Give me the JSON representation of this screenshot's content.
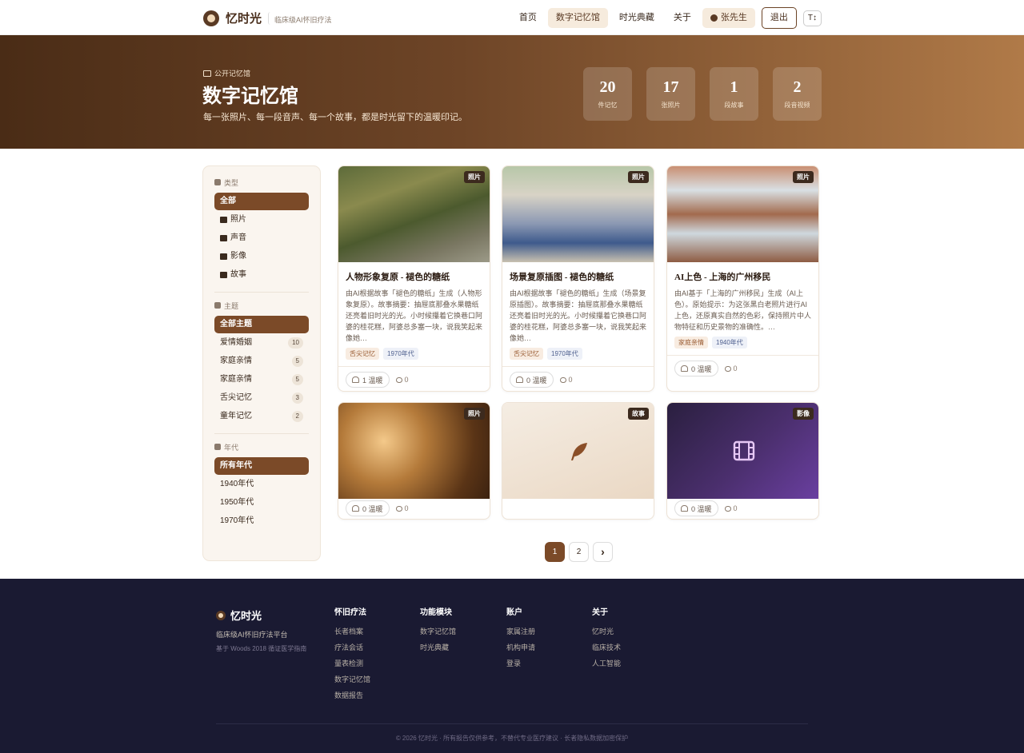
{
  "nav": {
    "brand": "忆时光",
    "tagline": "临床级AI怀旧疗法",
    "links": [
      "首页",
      "数字记忆馆",
      "时光典藏",
      "关于"
    ],
    "user": "张先生",
    "logout": "退出",
    "font_toggle": "T↕"
  },
  "hero": {
    "kicker": "公开记忆馆",
    "title": "数字记忆馆",
    "subtitle": "每一张照片、每一段音声、每一个故事，都是时光留下的温暖印记。",
    "stats": [
      {
        "num": "20",
        "label": "件记忆"
      },
      {
        "num": "17",
        "label": "张照片"
      },
      {
        "num": "1",
        "label": "段故事"
      },
      {
        "num": "2",
        "label": "段音视频"
      }
    ]
  },
  "sidebar": {
    "type_title": "类型",
    "types": [
      "全部",
      "照片",
      "声音",
      "影像",
      "故事"
    ],
    "theme_title": "主题",
    "themes_all": "全部主题",
    "themes": [
      {
        "label": "爱情婚姻",
        "count": "10"
      },
      {
        "label": "家庭亲情",
        "count": "5"
      },
      {
        "label": "家庭亲情",
        "count": "5"
      },
      {
        "label": "舌尖记忆",
        "count": "3"
      },
      {
        "label": "童年记忆",
        "count": "2"
      }
    ],
    "era_title": "年代",
    "eras": [
      "所有年代",
      "1940年代",
      "1950年代",
      "1970年代"
    ]
  },
  "cards": [
    {
      "badge": "照片",
      "title": "人物形象复原 - 褪色的糖纸",
      "desc": "由AI根据故事「褪色的糖纸」生成（人物形象复原）。故事摘要：抽屉底那叠水果糖纸还亮着旧时光的光。小时候攥着它换巷口阿婆的桂花糕，阿婆总多塞一块，说我笑起来像她…",
      "tags": [
        "舌尖记忆",
        "1970年代"
      ],
      "likes": "1 温暖",
      "comments": "0"
    },
    {
      "badge": "照片",
      "title": "场景复原插图 - 褪色的糖纸",
      "desc": "由AI根据故事「褪色的糖纸」生成（场景复原插图）。故事摘要：抽屉底那叠水果糖纸还亮着旧时光的光。小时候攥着它换巷口阿婆的桂花糕，阿婆总多塞一块，说我笑起来像她…",
      "tags": [
        "舌尖记忆",
        "1970年代"
      ],
      "likes": "0 温暖",
      "comments": "0"
    },
    {
      "badge": "照片",
      "title": "AI上色 - 上海的广州移民",
      "desc": "由AI基于「上海的广州移民」生成（AI上色）。原始提示：为这张黑白老照片进行AI上色，还原真实自然的色彩，保持照片中人物特征和历史景物的准确性。…",
      "tags": [
        "家庭亲情",
        "1940年代"
      ],
      "likes": "0 温暖",
      "comments": "0"
    },
    {
      "badge": "照片",
      "likes": "0 温暖",
      "comments": "0"
    },
    {
      "badge": "故事"
    },
    {
      "badge": "影像",
      "likes": "0 温暖",
      "comments": "0"
    }
  ],
  "pager": {
    "pages": [
      "1",
      "2"
    ],
    "next": "›"
  },
  "footer": {
    "brand": "忆时光",
    "line1": "临床级AI怀旧疗法平台",
    "line2": "基于 Woods 2018 循证医学指南",
    "cols": [
      {
        "title": "怀旧疗法",
        "links": [
          "长者档案",
          "疗法会话",
          "量表检测",
          "数字记忆馆",
          "数据报告"
        ]
      },
      {
        "title": "功能模块",
        "links": [
          "数字记忆馆",
          "时光典藏"
        ]
      },
      {
        "title": "账户",
        "links": [
          "家属注册",
          "机构申请",
          "登录"
        ]
      },
      {
        "title": "关于",
        "links": [
          "忆时光",
          "临床技术",
          "人工智能"
        ]
      }
    ],
    "copyright": "© 2026 忆时光 · 所有报告仅供参考，不替代专业医疗建议 · 长者隐私数据加密保护"
  }
}
